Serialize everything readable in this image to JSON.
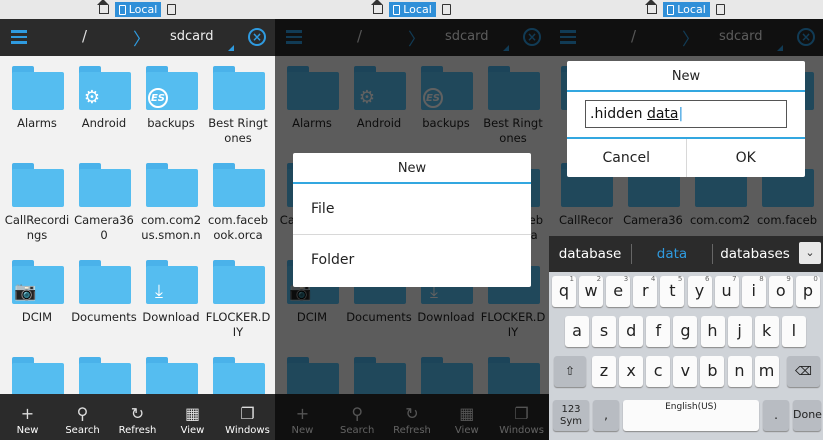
{
  "status": {
    "location_label": "Local"
  },
  "topbar": {
    "root": "/",
    "chevron": "〉",
    "crumb": "sdcard"
  },
  "folders": [
    {
      "label": "Alarms",
      "badge": ""
    },
    {
      "label": "Android",
      "badge": "⚙"
    },
    {
      "label": "backups",
      "badge": "ES"
    },
    {
      "label": "Best Ringtones",
      "badge": ""
    },
    {
      "label": "CallRecordings",
      "badge": ""
    },
    {
      "label": "Camera360",
      "badge": ""
    },
    {
      "label": "com.com2us.smon.n",
      "badge": ""
    },
    {
      "label": "com.facebook.orca",
      "badge": ""
    },
    {
      "label": "DCIM",
      "badge": "📷"
    },
    {
      "label": "Documents",
      "badge": ""
    },
    {
      "label": "Download",
      "badge": "⤓"
    },
    {
      "label": "FLOCKER.DIY",
      "badge": ""
    },
    {
      "label": "",
      "badge": ""
    },
    {
      "label": "",
      "badge": ""
    },
    {
      "label": "",
      "badge": ""
    },
    {
      "label": "",
      "badge": ""
    }
  ],
  "folders_p3": [
    {
      "label": "CallRecor"
    },
    {
      "label": "Camera36"
    },
    {
      "label": "com.com2"
    },
    {
      "label": "com.faceb"
    }
  ],
  "bottombar": [
    {
      "label": "New",
      "icon": "+"
    },
    {
      "label": "Search",
      "icon": "⚲"
    },
    {
      "label": "Refresh",
      "icon": "↻"
    },
    {
      "label": "View",
      "icon": "▦"
    },
    {
      "label": "Windows",
      "icon": "❐"
    }
  ],
  "dialog_new": {
    "title": "New",
    "options": [
      "File",
      "Folder"
    ]
  },
  "dialog_name": {
    "title": "New",
    "input_prefix": ".hidden ",
    "input_underlined": "data",
    "cancel": "Cancel",
    "ok": "OK"
  },
  "keyboard": {
    "suggestions": [
      "database",
      "data",
      "databases"
    ],
    "more": "⌄",
    "row1": [
      {
        "k": "q",
        "s": "1"
      },
      {
        "k": "w",
        "s": "2"
      },
      {
        "k": "e",
        "s": "3"
      },
      {
        "k": "r",
        "s": "4"
      },
      {
        "k": "t",
        "s": "5"
      },
      {
        "k": "y",
        "s": "6"
      },
      {
        "k": "u",
        "s": "7"
      },
      {
        "k": "i",
        "s": "8"
      },
      {
        "k": "o",
        "s": "9"
      },
      {
        "k": "p",
        "s": "0"
      }
    ],
    "row2": [
      "a",
      "s",
      "d",
      "f",
      "g",
      "h",
      "j",
      "k",
      "l"
    ],
    "row3": [
      "z",
      "x",
      "c",
      "v",
      "b",
      "n",
      "m"
    ],
    "shift": "⇧",
    "backspace": "⌫",
    "sym_label": "123\nSym",
    "comma": ",",
    "space_label": "English(US)",
    "period": ".",
    "done": "Done"
  }
}
